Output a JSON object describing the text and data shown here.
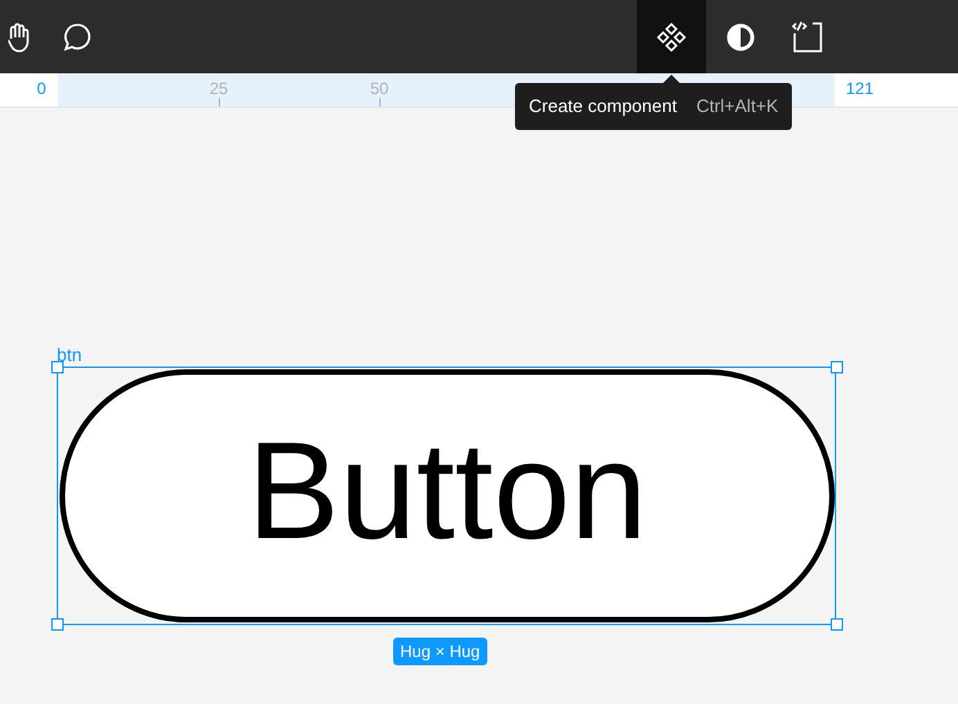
{
  "toolbar": {
    "tools": [
      {
        "kind": "hand",
        "selected": false
      },
      {
        "kind": "comment",
        "selected": false
      },
      {
        "kind": "component",
        "selected": true
      },
      {
        "kind": "contrast",
        "selected": false
      },
      {
        "kind": "code",
        "selected": false
      }
    ]
  },
  "ruler": {
    "labels": [
      {
        "text": "0",
        "selected": true
      },
      {
        "text": "25",
        "selected": false
      },
      {
        "text": "50",
        "selected": false
      },
      {
        "text": "121",
        "selected": true
      }
    ]
  },
  "tooltip": {
    "label": "Create component",
    "shortcut": "Ctrl+Alt+K"
  },
  "canvas": {
    "frame_name": "btn",
    "button_text": "Button",
    "size_badge": "Hug × Hug"
  }
}
